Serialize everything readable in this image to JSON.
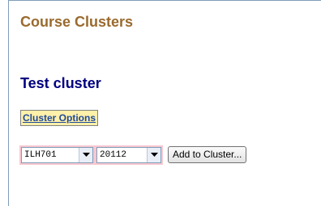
{
  "page": {
    "title": "Course Clusters"
  },
  "cluster": {
    "name": "Test cluster",
    "options_link_label": "Cluster Options"
  },
  "course_select": {
    "selected": "ILH701",
    "arrow_icon": "chevron-down-icon"
  },
  "term_select": {
    "selected": "20112",
    "arrow_icon": "chevron-down-icon"
  },
  "add_button": {
    "label": "Add to Cluster..."
  },
  "colors": {
    "page_title": "#9a6a2e",
    "cluster_title": "#000080",
    "link": "#1e4a9a",
    "link_background": "#fff0aa",
    "select_highlight": "#f7c7cf"
  }
}
